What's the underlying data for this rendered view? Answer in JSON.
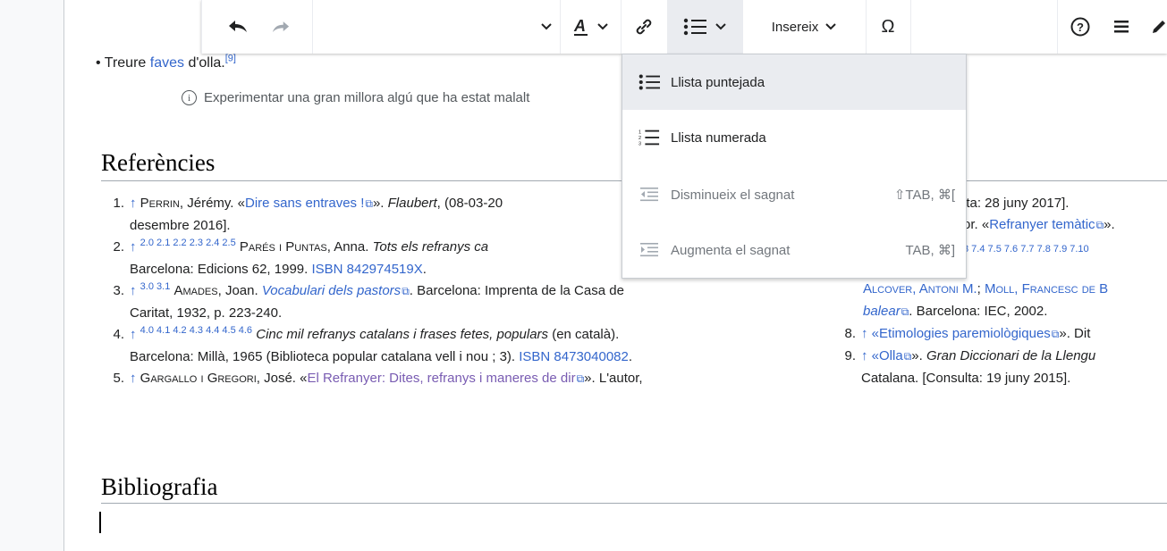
{
  "toolbar": {
    "insert_label": "Insereix",
    "special_char_label": "Ω"
  },
  "article": {
    "bullet_text_pre": "Treure ",
    "bullet_link": "faves",
    "bullet_text_post": " d'olla.",
    "bullet_ref": "[9]",
    "note_icon": "i",
    "note_text": "Experimentar una gran millora algú que ha estat malalt"
  },
  "headings": {
    "references": "Referències",
    "bibliography": "Bibliografia"
  },
  "references_left": [
    {
      "num": "1.",
      "arrow": "↑",
      "author": "Perrin",
      "author_rest": ", Jérémy. «",
      "link": "Dire sans entraves !",
      "after_link": "». ",
      "ital": "Flaubert",
      "tail": ", (08-03-20",
      "line2": "desembre 2016]."
    },
    {
      "num": "2.",
      "arrow": "↑",
      "sup": "2.0 2.1 2.2 2.3 2.4 2.5",
      "author": "Parés i Puntas",
      "author_rest": ", Anna. ",
      "ital": "Tots els refranys ca",
      "line2_pre": "Barcelona: Edicions 62, 1999. ",
      "isbn": "ISBN 842974519X",
      "line2_post": "."
    },
    {
      "num": "3.",
      "arrow": "↑",
      "sup": "3.0 3.1",
      "author": "Amades",
      "author_rest": ", Joan. ",
      "link": "Vocabulari dels pastors",
      "tail": ". Barcelona: Imprenta de la Casa de",
      "line2": "Caritat, 1932, p. 223-240."
    },
    {
      "num": "4.",
      "arrow": "↑",
      "sup": "4.0 4.1 4.2 4.3 4.4 4.5 4.6",
      "ital": "Cinc mil refranys catalans i frases fetes, populars",
      "tail": " (en català).",
      "line2_pre": "Barcelona: Millà, 1965 (Biblioteca popular catalana vell i nou ; 3). ",
      "isbn": "ISBN 8473040082",
      "line2_post": "."
    },
    {
      "num": "5.",
      "arrow": "↑",
      "author": "Gargallo i Gregori",
      "author_rest": ", José. «",
      "link": "El Refranyer: Dites, refranys i maneres de dir",
      "tail": "». L'autor,"
    }
  ],
  "references_right": {
    "r1": "lta: 28 juny 2017].",
    "r2_pre": "or. «",
    "r2_link": "Refranyer temàtic",
    "r2_post": "».",
    "r3_sup": "3 7.4 7.5 7.6 7.7 7.8 7.9 7.10",
    "r4_a1": "Alcover, Antoni M.",
    "r4_sep": "; ",
    "r4_a2": "Moll, Francesc de B",
    "r5_ital": "balear",
    "r5_tail": ". Barcelona: IEC, 2002.",
    "r8_num": "8.",
    "r8_pre": "↑ «",
    "r8_link": "Etimologies paremiològiques",
    "r8_post": "». Dit",
    "r9_num": "9.",
    "r9_pre": "↑ «",
    "r9_link": "Olla",
    "r9_mid": "». ",
    "r9_ital": "Gran Diccionari de la Llengu",
    "r9_line2": "Catalana. [Consulta: 19 juny 2015]."
  },
  "dropdown": {
    "items": [
      {
        "label": "Llista puntejada",
        "shortcut": ""
      },
      {
        "label": "Llista numerada",
        "shortcut": ""
      },
      {
        "label": "Disminueix el sagnat",
        "shortcut": "⇧TAB, ⌘["
      },
      {
        "label": "Augmenta el sagnat",
        "shortcut": "TAB, ⌘]"
      }
    ]
  },
  "colors": {
    "link": "#3366cc",
    "visited": "#795cb2",
    "hover_bg": "#eaecf0"
  }
}
